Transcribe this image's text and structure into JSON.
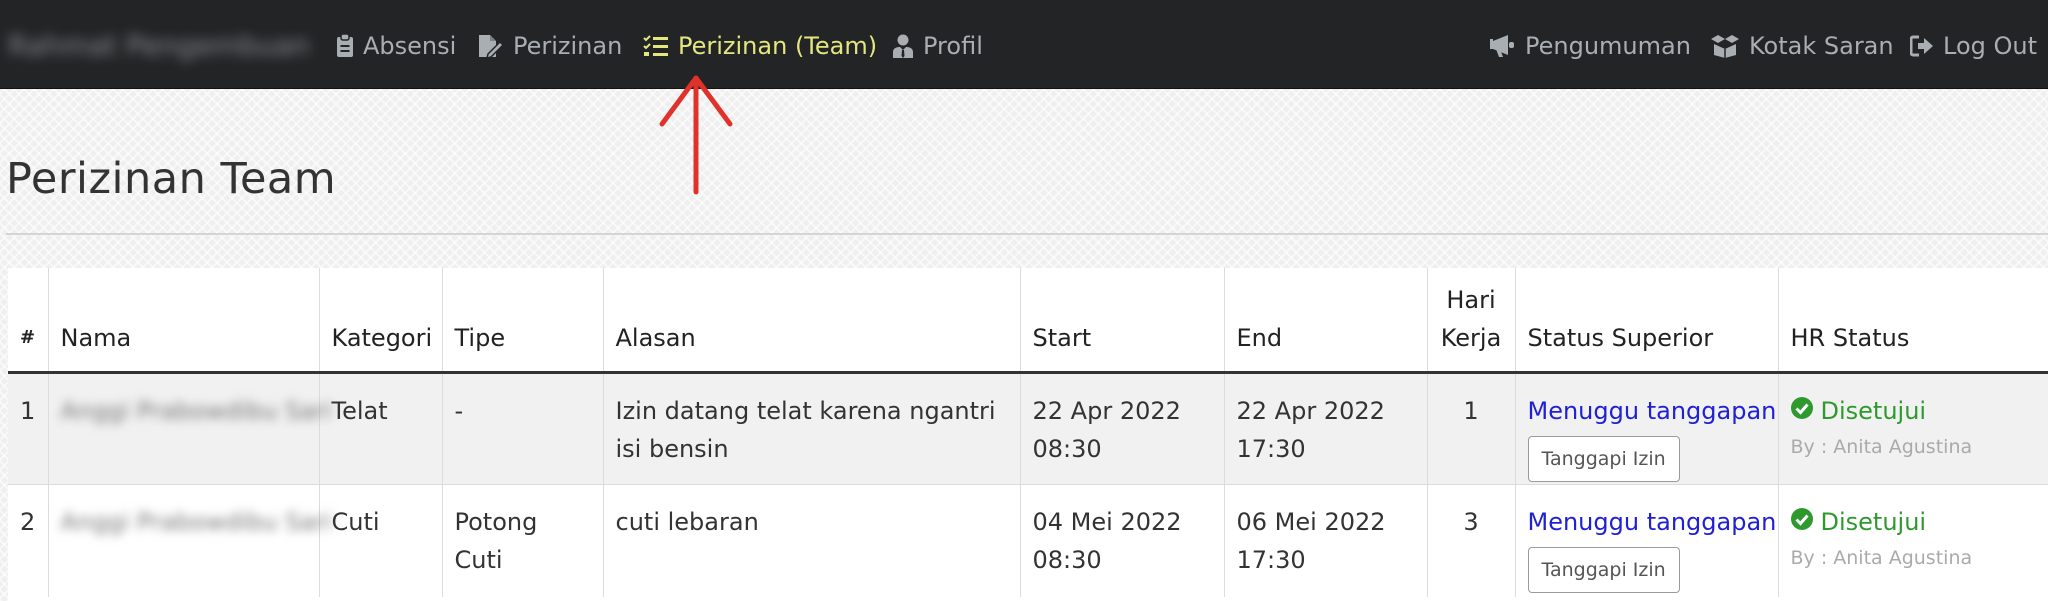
{
  "navbar": {
    "brand": "Rahmat Pengembuan",
    "items": [
      {
        "label": "Absensi",
        "icon": "clipboard-icon"
      },
      {
        "label": "Perizinan",
        "icon": "file-signature-icon"
      },
      {
        "label": "Perizinan (Team)",
        "icon": "tasks-icon",
        "active": true
      },
      {
        "label": "Profil",
        "icon": "user-tie-icon"
      }
    ],
    "right_items": [
      {
        "label": "Pengumuman",
        "icon": "bullhorn-icon"
      },
      {
        "label": "Kotak Saran",
        "icon": "box-open-icon"
      },
      {
        "label": "Log Out",
        "icon": "sign-out-icon"
      }
    ],
    "active_color": "#e6e67e"
  },
  "page": {
    "title": "Perizinan Team"
  },
  "table": {
    "headers": {
      "num": "#",
      "nama": "Nama",
      "kategori": "Kategori",
      "tipe": "Tipe",
      "alasan": "Alasan",
      "start": "Start",
      "end": "End",
      "hari_kerja_1": "Hari",
      "hari_kerja_2": "Kerja",
      "status_superior": "Status Superior",
      "hr_status": "HR Status"
    },
    "rows": [
      {
        "num": "1",
        "nama": "Anggi Prabowdibu Sari",
        "kategori": "Telat",
        "tipe": "-",
        "alasan": "Izin datang telat karena ngantri isi bensin",
        "start_date": "22 Apr 2022",
        "start_time": "08:30",
        "end_date": "22 Apr 2022",
        "end_time": "17:30",
        "hari_kerja": "1",
        "status_superior": "Menuggu tanggapan",
        "button": "Tanggapi Izin",
        "hr_status": "Disetujui",
        "hr_by": "By : Anita Agustina"
      },
      {
        "num": "2",
        "nama": "Anggi Prabowdibu Sari",
        "kategori": "Cuti",
        "tipe": "Potong Cuti",
        "alasan": "cuti lebaran",
        "start_date": "04 Mei 2022",
        "start_time": "08:30",
        "end_date": "06 Mei 2022",
        "end_time": "17:30",
        "hari_kerja": "3",
        "status_superior": "Menuggu tanggapan",
        "button": "Tanggapi Izin",
        "hr_status": "Disetujui",
        "hr_by": "By : Anita Agustina"
      }
    ],
    "link_color": "#2020d6",
    "approved_color": "#2e9a2e"
  }
}
